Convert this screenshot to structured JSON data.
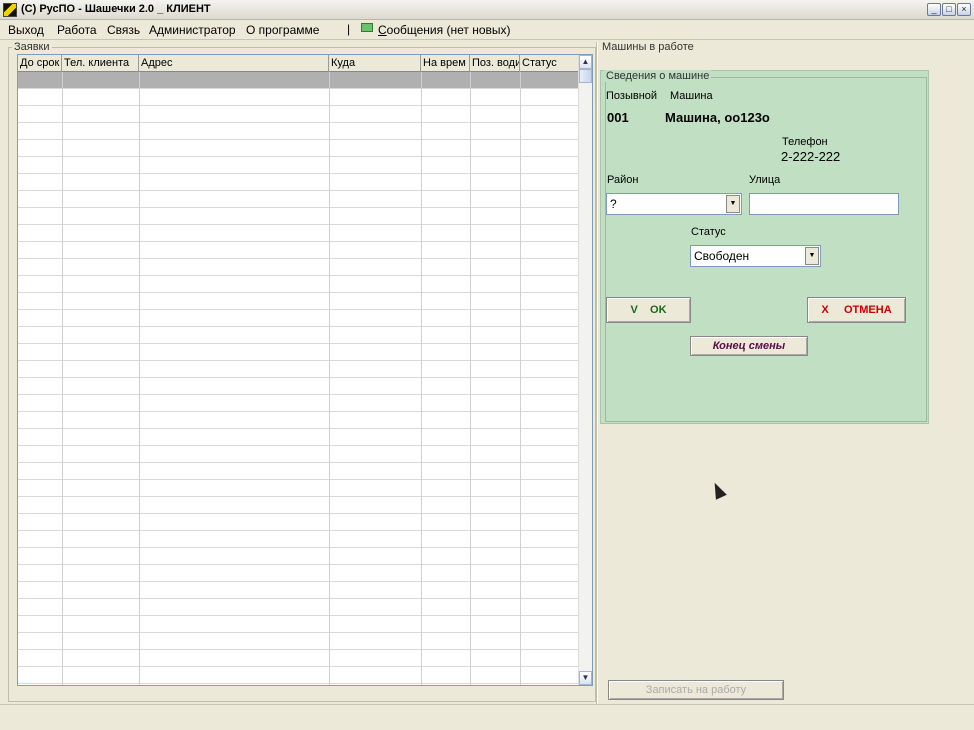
{
  "window": {
    "title": "(С) РусПО - Шашечки 2.0 _ КЛИЕНТ"
  },
  "menu": {
    "items": [
      "Выход",
      "Работа",
      "Связь",
      "Администратор",
      "О программе"
    ],
    "separator": "|",
    "messages": "Сообщения (нет новых)"
  },
  "orders": {
    "group_title": "Заявки",
    "columns": [
      "До срок",
      "Тел. клиента",
      "Адрес",
      "Куда",
      "На врем",
      "Поз. води",
      "Статус"
    ]
  },
  "cars": {
    "group_title": "Машины в работе",
    "panel_title": "Сведения о машине",
    "callsign_label": "Позывной",
    "car_label": "Машина",
    "callsign_value": "001",
    "car_value": "Машина, оо123о",
    "phone_label": "Телефон",
    "phone_value": "2-222-222",
    "district_label": "Район",
    "district_value": "?",
    "street_label": "Улица",
    "street_value": "",
    "status_label": "Статус",
    "status_value": "Свободен",
    "ok_label": "V    OK",
    "cancel_label": "X     ОТМЕНА",
    "end_shift_label": "Конец смены",
    "assign_label": "Записать на работу"
  },
  "icons": {
    "app": "taxi-checker-icon",
    "messages": "envelope-icon"
  }
}
